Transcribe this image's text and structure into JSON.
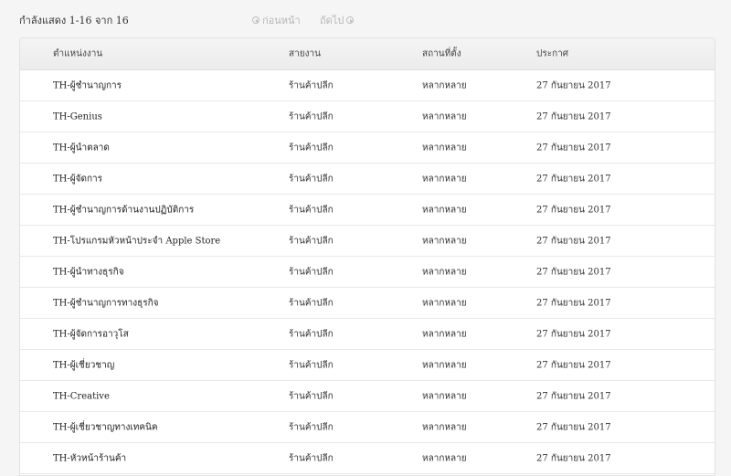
{
  "header": {
    "showing_text": "กำลังแสดง 1-16 จาก 16",
    "prev_label": "ก่อนหน้า",
    "next_label": "ถัดไป"
  },
  "table": {
    "columns": [
      "ตำแหน่งงาน",
      "สายงาน",
      "สถานที่ตั้ง",
      "ประกาศ"
    ],
    "rows": [
      {
        "title": "TH-ผู้ชำนาญการ",
        "team": "ร้านค้าปลีก",
        "location": "หลากหลาย",
        "posted": "27 กันยายน 2017"
      },
      {
        "title": "TH-Genius",
        "team": "ร้านค้าปลีก",
        "location": "หลากหลาย",
        "posted": "27 กันยายน 2017"
      },
      {
        "title": "TH-ผู้นำตลาด",
        "team": "ร้านค้าปลีก",
        "location": "หลากหลาย",
        "posted": "27 กันยายน 2017"
      },
      {
        "title": "TH-ผู้จัดการ",
        "team": "ร้านค้าปลีก",
        "location": "หลากหลาย",
        "posted": "27 กันยายน 2017"
      },
      {
        "title": "TH-ผู้ชำนาญการด้านงานปฏิบัติการ",
        "team": "ร้านค้าปลีก",
        "location": "หลากหลาย",
        "posted": "27 กันยายน 2017"
      },
      {
        "title": "TH-โปรแกรมหัวหน้าประจำ Apple Store",
        "team": "ร้านค้าปลีก",
        "location": "หลากหลาย",
        "posted": "27 กันยายน 2017"
      },
      {
        "title": "TH-ผู้นำทางธุรกิจ",
        "team": "ร้านค้าปลีก",
        "location": "หลากหลาย",
        "posted": "27 กันยายน 2017"
      },
      {
        "title": "TH-ผู้ชำนาญการทางธุรกิจ",
        "team": "ร้านค้าปลีก",
        "location": "หลากหลาย",
        "posted": "27 กันยายน 2017"
      },
      {
        "title": "TH-ผู้จัดการอาวุโส",
        "team": "ร้านค้าปลีก",
        "location": "หลากหลาย",
        "posted": "27 กันยายน 2017"
      },
      {
        "title": "TH-ผู้เชี่ยวชาญ",
        "team": "ร้านค้าปลีก",
        "location": "หลากหลาย",
        "posted": "27 กันยายน 2017"
      },
      {
        "title": "TH-Creative",
        "team": "ร้านค้าปลีก",
        "location": "หลากหลาย",
        "posted": "27 กันยายน 2017"
      },
      {
        "title": "TH-ผู้เชี่ยวชาญทางเทคนิค",
        "team": "ร้านค้าปลีก",
        "location": "หลากหลาย",
        "posted": "27 กันยายน 2017"
      },
      {
        "title": "TH-หัวหน้าร้านค้า",
        "team": "ร้านค้าปลีก",
        "location": "หลากหลาย",
        "posted": "27 กันยายน 2017"
      }
    ]
  }
}
